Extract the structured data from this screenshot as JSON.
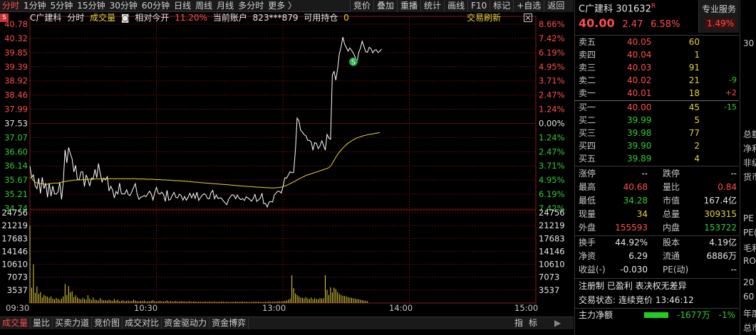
{
  "period_tabs": [
    "分时",
    "1分钟",
    "5分钟",
    "15分钟",
    "30分钟",
    "60分钟",
    "日线",
    "周线",
    "月线",
    "多分时",
    "更多 〉"
  ],
  "toolbar": [
    "竞价",
    "叠加",
    "重播",
    "统计",
    "画线",
    "F10",
    "标记",
    "+自选",
    "返回"
  ],
  "info": {
    "name": "C广建科",
    "label_fenshi": "分时",
    "label_volume": "成交量",
    "rel_open_label": "相对今开",
    "rel_open_value": "11.20%",
    "account_label": "当前账户",
    "account_value": "823***879",
    "available_label": "可用持仓",
    "available_value": "0",
    "refresh": "交易刷新",
    "corner_tag": "S"
  },
  "chart_data": {
    "type": "line",
    "prev_close": 37.53,
    "price_ticks_left": [
      "40.78",
      "40.32",
      "39.85",
      "39.39",
      "38.92",
      "38.46",
      "37.99",
      "37.53",
      "37.07",
      "36.60",
      "36.14",
      "35.67",
      "35.21",
      "34.74"
    ],
    "pct_ticks_right": [
      "8.66%",
      "7.42%",
      "6.19%",
      "4.95%",
      "3.71%",
      "2.47%",
      "1.24%",
      "0.00%",
      "1.24%",
      "2.47%",
      "3.71%",
      "4.95%",
      "6.19%",
      "7.42%"
    ],
    "price_range": [
      34.55,
      40.85
    ],
    "volume_ticks": [
      "24756",
      "21219",
      "17683",
      "14146",
      "10610",
      "7073",
      "3537"
    ],
    "volume_max": 24756,
    "time_labels": [
      "09:30",
      "10:30",
      "13:00",
      "14:00",
      "15:00"
    ],
    "trade_marker": "S",
    "price_series": [
      36.0,
      35.62,
      35.7,
      35.33,
      35.23,
      35.59,
      35.06,
      35.62,
      35.23,
      35.42,
      34.93,
      35.42,
      34.97,
      35.32,
      35.05,
      35.04,
      35.12,
      35.45,
      34.86,
      35.48,
      36.56,
      36.11,
      36.64,
      36.43,
      36.25,
      35.8,
      36.03,
      35.55,
      35.53,
      35.8,
      35.81,
      35.3,
      35.7,
      35.54,
      35.32,
      35.59,
      35.56,
      35.89,
      35.6,
      36.09,
      35.75,
      35.46,
      35.59,
      35.53,
      35.64,
      35.15,
      35.31,
      35.18,
      34.91,
      35.13,
      35.05,
      35.42,
      35.06,
      35.04,
      35.05,
      35.19,
      35.02,
      34.99,
      35.13,
      35.27,
      35.4,
      35.04,
      34.86,
      34.93,
      34.95,
      34.99,
      34.95,
      35.05,
      35.14,
      35.05,
      34.84,
      35.1,
      35.27,
      35.07,
      35.04,
      35.11,
      35.03,
      34.79,
      35.17,
      34.83,
      34.86,
      35.0,
      35.1,
      34.93,
      34.91,
      35.04,
      34.99,
      34.83,
      34.96,
      34.83,
      34.94,
      35.07,
      34.91,
      35.06,
      34.89,
      35.11,
      34.82,
      34.92,
      35.0,
      35.05,
      35.02,
      34.89,
      34.88,
      35.09,
      35.17,
      34.88,
      35.01,
      34.89,
      34.91,
      34.9,
      34.81,
      34.74,
      34.68,
      34.86,
      34.95,
      35.02,
      35.0,
      34.88,
      35.01,
      34.9,
      34.85,
      34.89,
      34.82,
      34.95,
      34.91,
      34.86,
      34.8,
      34.88,
      35.03,
      34.79,
      34.84,
      34.9,
      35.07,
      34.71,
      34.72,
      34.6,
      34.76,
      34.79,
      34.77,
      35.0,
      35.08,
      35.14,
      35.13,
      35.08,
      35.31,
      35.6,
      35.59,
      35.7,
      35.81,
      35.77,
      35.79,
      36.55,
      37.65,
      37.55,
      37.23,
      37.17,
      37.08,
      37.04,
      36.89,
      36.89,
      36.83,
      36.55,
      36.81,
      36.78,
      36.6,
      36.7,
      36.87,
      36.72,
      36.55,
      37.09,
      36.97,
      36.92,
      39.13,
      39.25,
      38.95,
      39.34,
      39.85,
      40.1,
      40.43,
      40.19,
      40.07,
      39.95,
      40.06,
      39.97,
      39.88,
      39.75,
      39.55,
      39.9,
      40.05,
      40.29,
      40.11,
      39.93,
      39.91,
      40.08,
      40.04,
      39.89,
      39.98,
      40.0,
      39.9,
      39.95,
      40.02
    ],
    "avg_series": [
      35.6,
      35.6,
      35.5,
      35.45,
      35.42,
      35.42,
      35.4,
      35.4,
      35.38,
      35.38,
      35.38,
      35.4,
      35.4,
      35.42,
      35.42,
      35.42,
      35.42,
      35.43,
      35.45,
      35.47,
      35.47,
      35.48,
      35.5,
      35.5,
      35.51,
      35.52,
      35.52,
      35.53,
      35.53,
      35.53,
      35.54,
      35.54,
      35.54,
      35.55,
      35.55,
      35.55,
      35.55,
      35.56,
      35.56,
      35.56,
      35.56,
      35.57,
      35.57,
      35.57,
      35.57,
      35.57,
      35.57,
      35.57,
      35.57,
      35.57,
      35.57,
      35.57,
      35.57,
      35.57,
      35.57,
      35.57,
      35.57,
      35.57,
      35.57,
      35.57,
      35.57,
      35.56,
      35.56,
      35.56,
      35.56,
      35.56,
      35.55,
      35.55,
      35.55,
      35.55,
      35.55,
      35.54,
      35.54,
      35.54,
      35.54,
      35.53,
      35.53,
      35.53,
      35.52,
      35.52,
      35.52,
      35.51,
      35.51,
      35.5,
      35.5,
      35.5,
      35.49,
      35.49,
      35.48,
      35.48,
      35.47,
      35.47,
      35.46,
      35.46,
      35.45,
      35.45,
      35.44,
      35.44,
      35.43,
      35.43,
      35.42,
      35.42,
      35.41,
      35.41,
      35.4,
      35.4,
      35.39,
      35.39,
      35.38,
      35.38,
      35.37,
      35.37,
      35.36,
      35.36,
      35.35,
      35.35,
      35.34,
      35.34,
      35.33,
      35.33,
      35.32,
      35.32,
      35.31,
      35.31,
      35.3,
      35.3,
      35.3,
      35.29,
      35.29,
      35.28,
      35.28,
      35.28,
      35.27,
      35.27,
      35.26,
      35.26,
      35.26,
      35.25,
      35.25,
      35.25,
      35.26,
      35.26,
      35.27,
      35.28,
      35.3,
      35.32,
      35.34,
      35.37,
      35.4,
      35.43,
      35.46,
      35.49,
      35.53,
      35.56,
      35.59,
      35.62,
      35.65,
      35.68,
      35.7,
      35.72,
      35.74,
      35.76,
      35.78,
      35.8,
      35.82,
      35.84,
      35.86,
      35.88,
      35.9,
      35.92,
      35.95,
      36.0,
      36.1,
      36.2,
      36.3,
      36.4,
      36.48,
      36.55,
      36.62,
      36.68,
      36.74,
      36.79,
      36.83,
      36.87,
      36.91,
      36.94,
      36.97,
      36.99,
      37.01,
      37.03,
      37.05,
      37.06,
      37.08,
      37.09,
      37.1,
      37.11,
      37.12,
      37.13,
      37.14,
      37.15
    ],
    "volume_series": [
      21200,
      4200,
      10600,
      2800,
      4500,
      2500,
      3000,
      1500,
      2200,
      1900,
      1700,
      1400,
      1800,
      1200,
      1000,
      1400,
      1100,
      900,
      1200,
      1800,
      5200,
      2200,
      4600,
      3000,
      3200,
      1600,
      2100,
      1500,
      1200,
      1000,
      1400,
      1100,
      900,
      2100,
      1200,
      800,
      1500,
      900,
      800,
      700,
      1300,
      900,
      700,
      800,
      650,
      900,
      700,
      600,
      1100,
      700,
      900,
      500,
      600,
      800,
      500,
      600,
      700,
      500,
      600,
      900,
      700,
      500,
      450,
      600,
      500,
      700,
      400,
      500,
      450,
      600,
      800,
      500,
      400,
      500,
      600,
      450,
      400,
      500,
      700,
      400,
      500,
      450,
      400,
      600,
      350,
      400,
      500,
      450,
      400,
      350,
      400,
      500,
      350,
      400,
      450,
      300,
      400,
      350,
      300,
      400,
      350,
      300,
      400,
      350,
      300,
      450,
      300,
      350,
      300,
      400,
      350,
      300,
      350,
      300,
      250,
      350,
      300,
      400,
      350,
      300,
      350,
      400,
      300,
      350,
      300,
      250,
      350,
      300,
      400,
      300,
      350,
      300,
      250,
      300,
      350,
      300,
      450,
      350,
      300,
      400,
      350,
      500,
      450,
      400,
      500,
      600,
      700,
      900,
      1200,
      7600,
      4100,
      2600,
      2200,
      1800,
      1500,
      1400,
      1300,
      1600,
      1200,
      1100,
      1500,
      1000,
      1300,
      1100,
      1000,
      1400,
      1200,
      1300,
      7600,
      3600,
      2200,
      4300,
      2900,
      4200,
      3800,
      3000,
      2500,
      2200,
      2000,
      1900,
      1800,
      1600,
      1500,
      1400,
      1300,
      1200,
      1100,
      1000,
      900,
      800,
      700,
      600,
      500
    ],
    "volume_series_colors": "yellow"
  },
  "bottom_tabs": [
    "成交量",
    "量比",
    "买卖力道",
    "竞价图",
    "成交对比",
    "资金驱动力",
    "资金博弈"
  ],
  "bottom_right": {
    "label1": "指",
    "label2": "标",
    "arrows": "▶"
  },
  "panel": {
    "name": "C广建科",
    "code": "301632",
    "code_suffix": "R",
    "service": "专业服务",
    "service_value": "1.49%",
    "price": "40.00",
    "change": "2.47",
    "change_pct": "6.58%",
    "asks": [
      {
        "label": "卖五",
        "price": "40.05",
        "vol": "60",
        "delta": ""
      },
      {
        "label": "卖四",
        "price": "40.04",
        "vol": "1",
        "delta": ""
      },
      {
        "label": "卖三",
        "price": "40.03",
        "vol": "91",
        "delta": ""
      },
      {
        "label": "卖二",
        "price": "40.02",
        "vol": "21",
        "delta": "-9"
      },
      {
        "label": "卖一",
        "price": "40.01",
        "vol": "18",
        "delta": "+2"
      }
    ],
    "bids": [
      {
        "label": "买一",
        "price": "40.00",
        "vol": "45",
        "delta": "-15"
      },
      {
        "label": "买二",
        "price": "39.99",
        "vol": "5",
        "delta": ""
      },
      {
        "label": "买三",
        "price": "39.98",
        "vol": "77",
        "delta": ""
      },
      {
        "label": "买四",
        "price": "39.90",
        "vol": "2",
        "delta": ""
      },
      {
        "label": "买五",
        "price": "39.89",
        "vol": "4",
        "delta": ""
      }
    ],
    "stats": [
      {
        "l1": "涨停",
        "v1": "--",
        "l2": "跌停",
        "v2": "--"
      },
      {
        "l1": "最高",
        "v1": "40.68",
        "l2": "量比",
        "v2": "0.84"
      },
      {
        "l1": "最低",
        "v1": "34.28",
        "l2": "市值",
        "v2": "167.4亿"
      },
      {
        "l1": "现量",
        "v1": "34",
        "l2": "总量",
        "v2": "309315"
      },
      {
        "l1": "外盘",
        "v1": "155593",
        "l2": "内盘",
        "v2": "153722"
      }
    ],
    "stats2": [
      {
        "l1": "换手",
        "v1": "44.92%",
        "l2": "股本",
        "v2": "4.19亿"
      },
      {
        "l1": "净资",
        "v1": "6.29",
        "l2": "流通",
        "v2": "6886万"
      },
      {
        "l1": "收益(-)",
        "v1": "-0.030",
        "l2": "PE(动)",
        "v2": "--"
      }
    ],
    "tags": "注册制 已盈利 表决权无差异",
    "status_label": "交易状态:",
    "status_value": "连续竞价 13:46:12",
    "net_label": "主力净额",
    "net_value": "-1677万",
    "net_pct": "-1%"
  },
  "far_right": [
    "30",
    "总额",
    "净利",
    "非级",
    "货币",
    "PE",
    "PE(",
    "毛利",
    "RO",
    "20",
    "60",
    "年度",
    "总市"
  ]
}
